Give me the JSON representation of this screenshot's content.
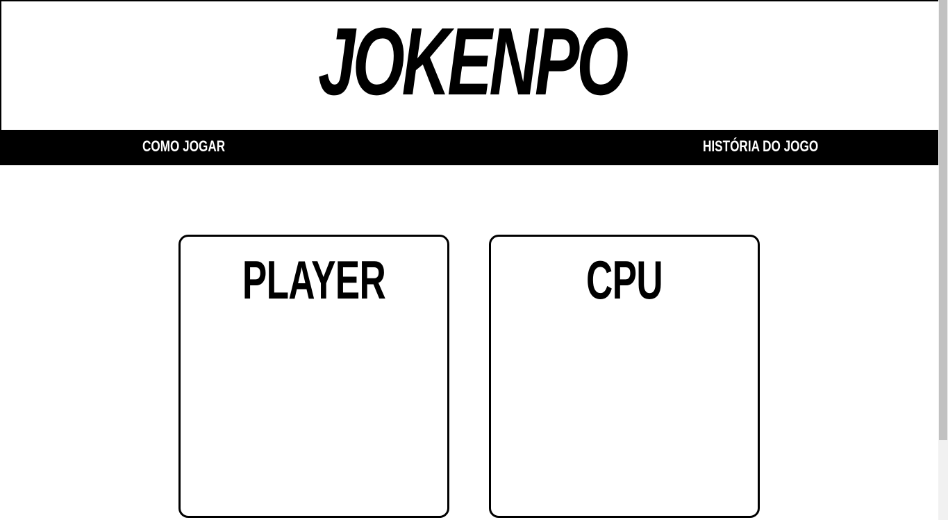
{
  "header": {
    "logo_text": "JOKENPO"
  },
  "nav": {
    "items": [
      {
        "label": "COMO JOGAR"
      },
      {
        "label": "HISTÓRIA DO JOGO"
      }
    ]
  },
  "board": {
    "player_title": "PLAYER",
    "cpu_title": "CPU"
  },
  "scrollbar": {
    "position_fraction": 0.0
  },
  "colors": {
    "background": "#ffffff",
    "foreground": "#000000",
    "nav_background": "#000000",
    "nav_text": "#ffffff"
  }
}
